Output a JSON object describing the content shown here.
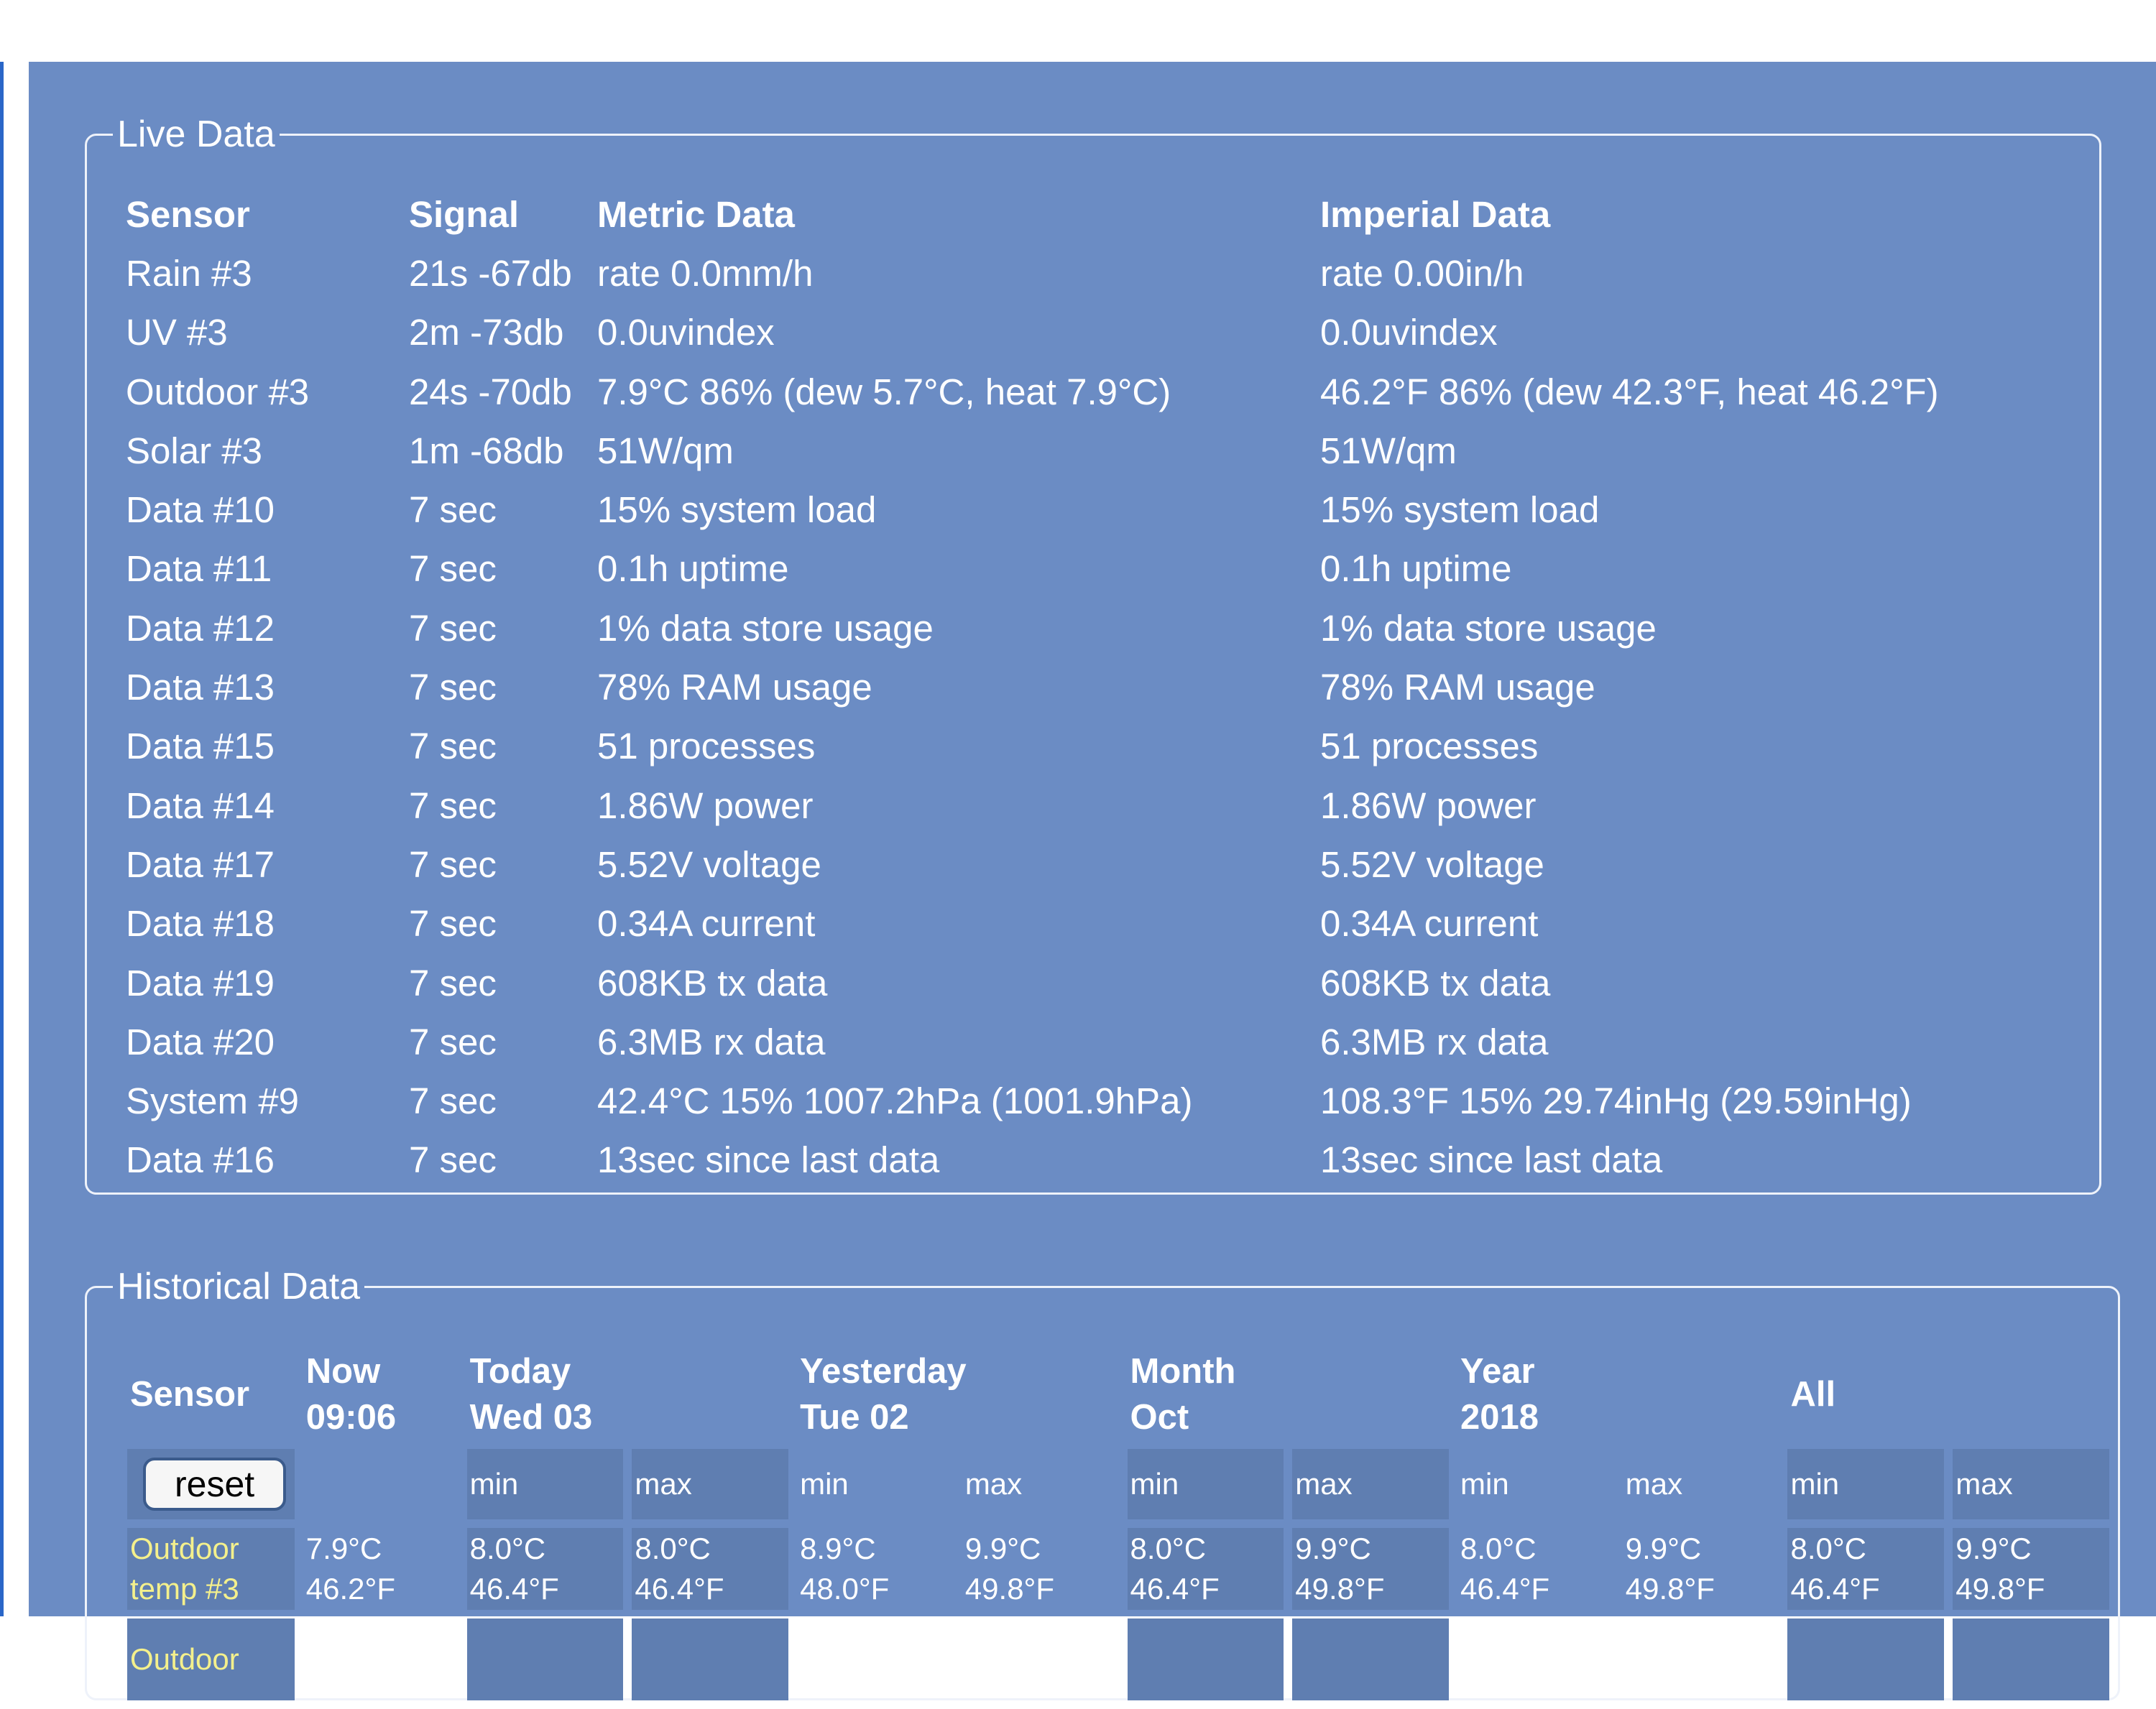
{
  "live": {
    "legend": "Live Data",
    "headers": [
      "Sensor",
      "Signal",
      "Metric Data",
      "Imperial Data"
    ],
    "rows": [
      {
        "sensor": "Rain #3",
        "signal": "21s -67db",
        "metric": "rate 0.0mm/h",
        "imperial": "rate 0.00in/h"
      },
      {
        "sensor": "UV #3",
        "signal": "2m -73db",
        "metric": "0.0uvindex",
        "imperial": "0.0uvindex"
      },
      {
        "sensor": "Outdoor #3",
        "signal": "24s -70db",
        "metric": "7.9°C 86% (dew 5.7°C, heat 7.9°C)",
        "imperial": "46.2°F 86% (dew 42.3°F, heat 46.2°F)"
      },
      {
        "sensor": "Solar #3",
        "signal": "1m -68db",
        "metric": "51W/qm",
        "imperial": "51W/qm"
      },
      {
        "sensor": "Data #10",
        "signal": "7 sec",
        "metric": "15% system load",
        "imperial": "15% system load"
      },
      {
        "sensor": "Data #11",
        "signal": "7 sec",
        "metric": "0.1h uptime",
        "imperial": "0.1h uptime"
      },
      {
        "sensor": "Data #12",
        "signal": "7 sec",
        "metric": "1% data store usage",
        "imperial": "1% data store usage"
      },
      {
        "sensor": "Data #13",
        "signal": "7 sec",
        "metric": "78% RAM usage",
        "imperial": "78% RAM usage"
      },
      {
        "sensor": "Data #15",
        "signal": "7 sec",
        "metric": "51 processes",
        "imperial": "51 processes"
      },
      {
        "sensor": "Data #14",
        "signal": "7 sec",
        "metric": "1.86W power",
        "imperial": "1.86W power"
      },
      {
        "sensor": "Data #17",
        "signal": "7 sec",
        "metric": "5.52V voltage",
        "imperial": "5.52V voltage"
      },
      {
        "sensor": "Data #18",
        "signal": "7 sec",
        "metric": "0.34A current",
        "imperial": "0.34A current"
      },
      {
        "sensor": "Data #19",
        "signal": "7 sec",
        "metric": "608KB tx data",
        "imperial": "608KB tx data"
      },
      {
        "sensor": "Data #20",
        "signal": "7 sec",
        "metric": "6.3MB rx data",
        "imperial": "6.3MB rx data"
      },
      {
        "sensor": "System #9",
        "signal": "7 sec",
        "metric": "42.4°C 15% 1007.2hPa (1001.9hPa)",
        "imperial": "108.3°F 15% 29.74inHg (29.59inHg)"
      },
      {
        "sensor": "Data #16",
        "signal": "7 sec",
        "metric": "13sec since last data",
        "imperial": "13sec since last data"
      }
    ]
  },
  "historical": {
    "legend": "Historical Data",
    "headers": {
      "sensor": "Sensor",
      "now": {
        "line1": "Now",
        "line2": "09:06"
      },
      "today": {
        "line1": "Today",
        "line2": "Wed 03"
      },
      "yesterday": {
        "line1": "Yesterday",
        "line2": "Tue 02"
      },
      "month": {
        "line1": "Month",
        "line2": "Oct"
      },
      "year": {
        "line1": "Year",
        "line2": "2018"
      },
      "all": "All"
    },
    "reset_label": "reset",
    "min_label": "min",
    "max_label": "max",
    "rows": [
      {
        "sensor_line1": "Outdoor",
        "sensor_line2": "temp #3",
        "now": {
          "c": "7.9°C",
          "f": "46.2°F"
        },
        "today_min": {
          "c": "8.0°C",
          "f": "46.4°F"
        },
        "today_max": {
          "c": "8.0°C",
          "f": "46.4°F"
        },
        "yesterday_min": {
          "c": "8.9°C",
          "f": "48.0°F"
        },
        "yesterday_max": {
          "c": "9.9°C",
          "f": "49.8°F"
        },
        "month_min": {
          "c": "8.0°C",
          "f": "46.4°F"
        },
        "month_max": {
          "c": "9.9°C",
          "f": "49.8°F"
        },
        "year_min": {
          "c": "8.0°C",
          "f": "46.4°F"
        },
        "year_max": {
          "c": "9.9°C",
          "f": "49.8°F"
        },
        "all_min": {
          "c": "8.0°C",
          "f": "46.4°F"
        },
        "all_max": {
          "c": "9.9°C",
          "f": "49.8°F"
        }
      },
      {
        "sensor_line1": "Outdoor"
      }
    ]
  }
}
